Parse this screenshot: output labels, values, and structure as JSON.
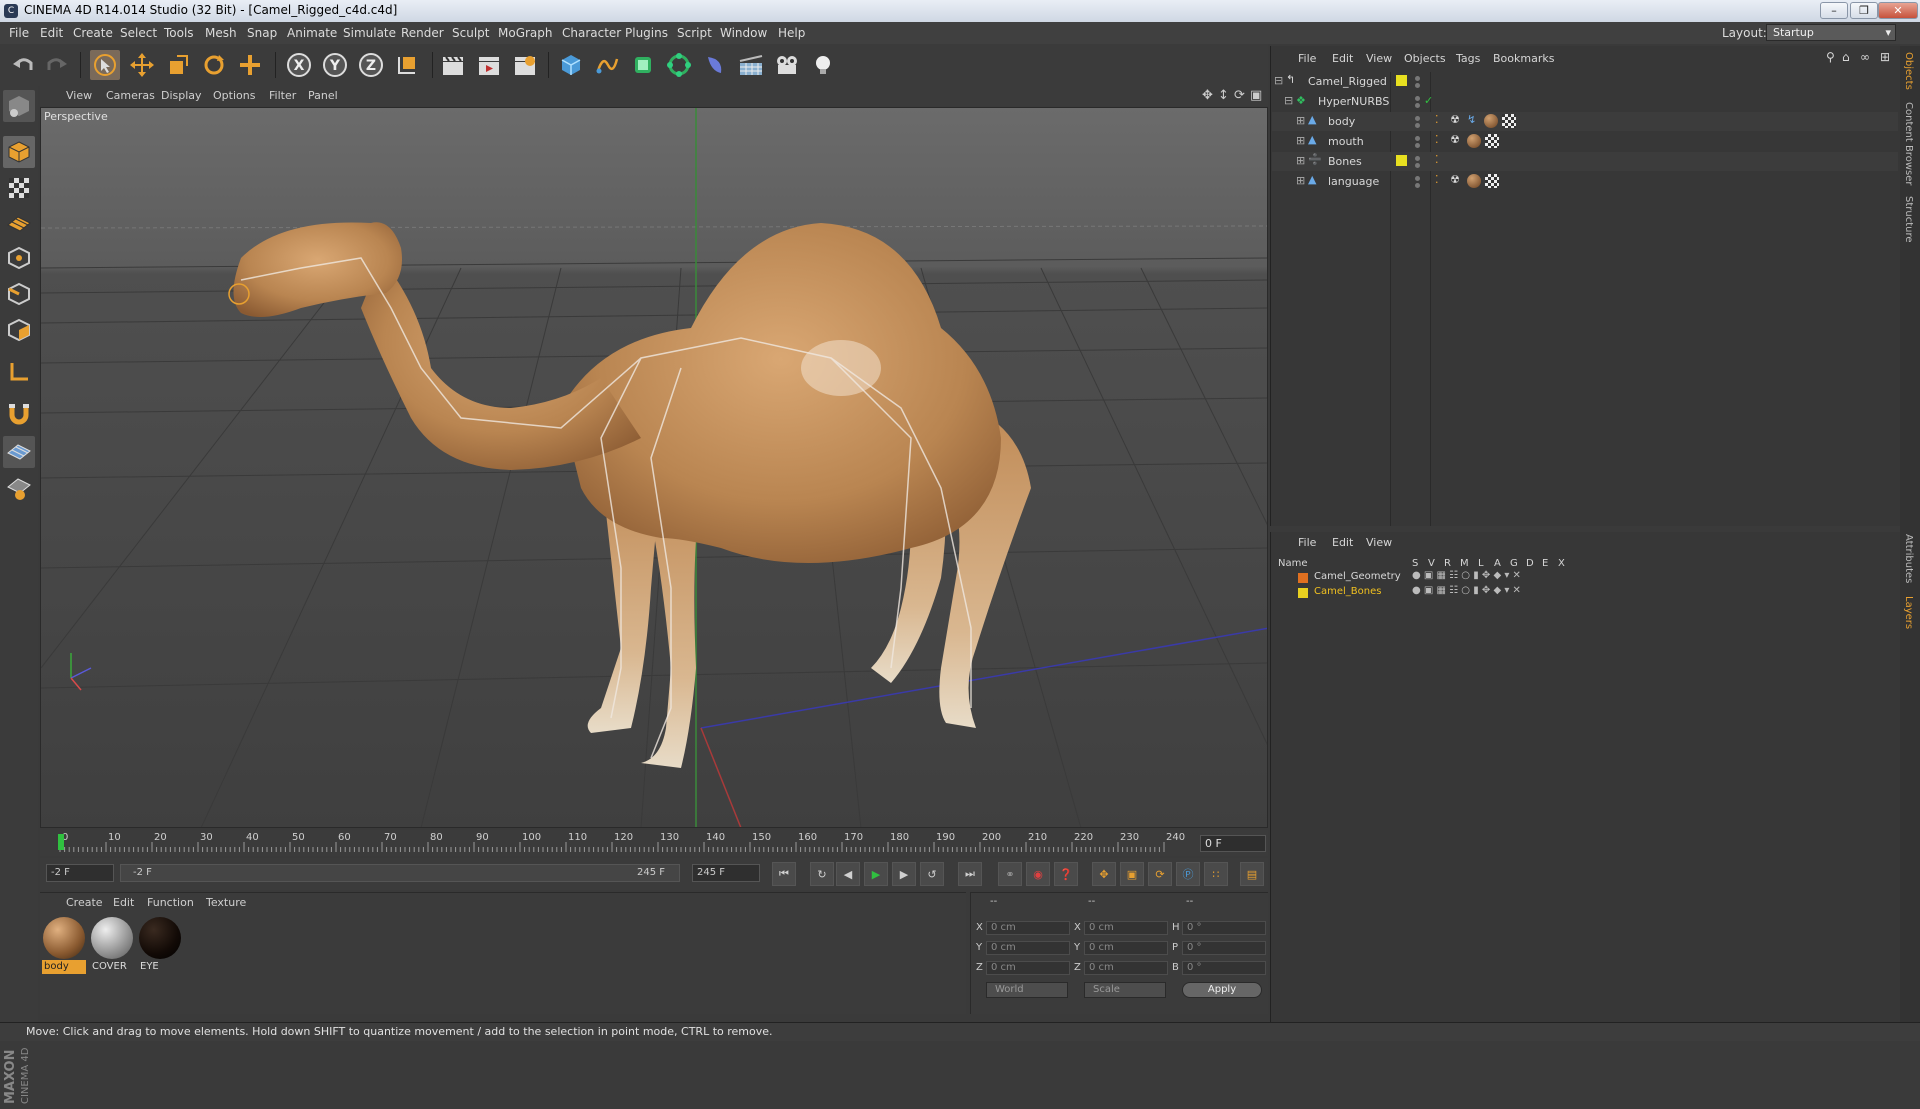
{
  "window": {
    "title": "CINEMA 4D R14.014 Studio (32 Bit) - [Camel_Rigged_c4d.c4d]",
    "app_icon": "C"
  },
  "menubar": {
    "items": [
      "File",
      "Edit",
      "Create",
      "Select",
      "Tools",
      "Mesh",
      "Snap",
      "Animate",
      "Simulate",
      "Render",
      "Sculpt",
      "MoGraph",
      "Character",
      "Plugins",
      "Script",
      "Window",
      "Help"
    ],
    "layout_label": "Layout:",
    "layout_value": "Startup"
  },
  "toolbar": {
    "axis_labels": [
      "X",
      "Y",
      "Z"
    ]
  },
  "viewport": {
    "menu": [
      "View",
      "Cameras",
      "Display",
      "Options",
      "Filter",
      "Panel"
    ],
    "camera_label": "Perspective"
  },
  "timeline": {
    "ticks": [
      "0",
      "10",
      "20",
      "30",
      "40",
      "50",
      "60",
      "70",
      "80",
      "90",
      "100",
      "110",
      "120",
      "130",
      "140",
      "150",
      "160",
      "170",
      "180",
      "190",
      "200",
      "210",
      "220",
      "230",
      "240"
    ],
    "current_frame": "0 F"
  },
  "anim": {
    "start": "-2 F",
    "range_start": "-2 F",
    "range_end": "245 F",
    "end": "245 F"
  },
  "materials": {
    "menu": [
      "Create",
      "Edit",
      "Function",
      "Texture"
    ],
    "items": [
      {
        "name": "body",
        "selected": true
      },
      {
        "name": "COVER",
        "selected": false
      },
      {
        "name": "EYE",
        "selected": false
      }
    ]
  },
  "coordinates": {
    "header": [
      "--",
      "--",
      "--"
    ],
    "rows": [
      {
        "l1": "X",
        "v1": "0 cm",
        "l2": "X",
        "v2": "0 cm",
        "l3": "H",
        "v3": "0 °"
      },
      {
        "l1": "Y",
        "v1": "0 cm",
        "l2": "Y",
        "v2": "0 cm",
        "l3": "P",
        "v3": "0 °"
      },
      {
        "l1": "Z",
        "v1": "0 cm",
        "l2": "Z",
        "v2": "0 cm",
        "l3": "B",
        "v3": "0 °"
      }
    ],
    "mode": "World",
    "type": "Scale",
    "apply": "Apply"
  },
  "object_manager": {
    "menu": [
      "File",
      "Edit",
      "View",
      "Objects",
      "Tags",
      "Bookmarks"
    ],
    "objects": [
      {
        "name": "Camel_Rigged",
        "depth": 0,
        "color": "#e8e020"
      },
      {
        "name": "HyperNURBS",
        "depth": 1,
        "color": ""
      },
      {
        "name": "body",
        "depth": 2,
        "color": ""
      },
      {
        "name": "mouth",
        "depth": 2,
        "color": ""
      },
      {
        "name": "Bones",
        "depth": 2,
        "color": "#e8e020"
      },
      {
        "name": "language",
        "depth": 2,
        "color": ""
      }
    ]
  },
  "layer_manager": {
    "menu": [
      "File",
      "Edit",
      "View"
    ],
    "columns": [
      "Name",
      "S",
      "V",
      "R",
      "M",
      "L",
      "A",
      "G",
      "D",
      "E",
      "X"
    ],
    "layers": [
      {
        "name": "Camel_Geometry",
        "color": "#e07020",
        "text_color": "#d9d9d9"
      },
      {
        "name": "Camel_Bones",
        "color": "#e8d020",
        "text_color": "#f0c020"
      }
    ]
  },
  "right_tabs": [
    "Objects",
    "Content Browser",
    "Structure",
    "Attributes",
    "Layers"
  ],
  "status": "Move: Click and drag to move elements. Hold down SHIFT to quantize movement / add to the selection in point mode, CTRL to remove.",
  "brand": {
    "maxon": "MAXON",
    "product": "CINEMA 4D"
  },
  "colors": {
    "accent_orange": "#e8a030",
    "selection_yellow": "#e8e020",
    "play_green": "#30c040"
  }
}
